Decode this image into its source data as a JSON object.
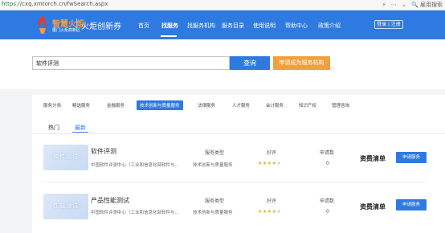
{
  "browser": {
    "url_scheme": "https://",
    "url_rest": "cxq.xmtorch.cn/fwSearch.aspx",
    "right_text": "🔍 雇用搜索"
  },
  "header": {
    "logo_name": "智慧火炬",
    "logo_sub": "厦门火炬高新区",
    "brand": "火炬创新券",
    "nav": [
      "首页",
      "找服务",
      "找服务机构",
      "服务目录",
      "使用说明",
      "帮助中心",
      "政策介绍"
    ],
    "active_nav": "找服务",
    "login": "登录 | 注册",
    "colors": {
      "header_bg": "#2f7ae0",
      "logo_orange": "#ff9a3c"
    }
  },
  "search": {
    "value": "软件评测",
    "button": "查询",
    "apply_button": "申请成为服务机构"
  },
  "categories": {
    "label": "服务分类:",
    "items": [
      "精选服务",
      "金融服务",
      "技术创新与质量服务",
      "法律服务",
      "人才服务",
      "会计服务",
      "知识产权",
      "管理咨询"
    ],
    "active": "技术创新与质量服务"
  },
  "tabs": {
    "items": [
      "热门",
      "最新"
    ],
    "active": "最新"
  },
  "columns": {
    "type": "服务类型",
    "rating": "好评",
    "count": "申请数"
  },
  "services": [
    {
      "image_text": "软件测试",
      "title": "软件评测",
      "desc": "中国软件评测中心（工业和信息化部软件与...",
      "type": "技术创新与质量服务",
      "rating": 4,
      "rating_max": 5,
      "count": "0",
      "bill": "资费清单",
      "apply": "申请服务"
    },
    {
      "image_text": "性能测试",
      "title": "产品性能测试",
      "desc": "中国软件评测中心（工业和信息化部软件与...",
      "type": "技术创新与质量服务",
      "rating": 4,
      "rating_max": 5,
      "count": "0",
      "bill": "资费清单",
      "apply": "申请服务"
    }
  ]
}
